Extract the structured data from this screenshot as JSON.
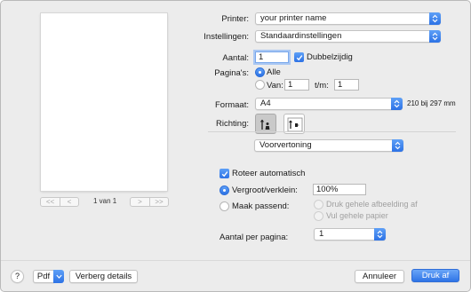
{
  "preview": {
    "page_counter": "1 van 1",
    "nav": {
      "first": "<<",
      "prev": "<",
      "next": ">",
      "last": ">>"
    }
  },
  "printer": {
    "label": "Printer:",
    "value": "your printer name"
  },
  "presets": {
    "label": "Instellingen:",
    "value": "Standaardinstellingen"
  },
  "copies": {
    "label": "Aantal:",
    "value": "1",
    "duplex_label": "Dubbelzijdig",
    "duplex_checked": true
  },
  "pages": {
    "label": "Pagina's:",
    "all_label": "Alle",
    "from_label": "Van:",
    "from_value": "1",
    "to_label": "t/m:",
    "to_value": "1",
    "selected": "all"
  },
  "paper": {
    "label": "Formaat:",
    "value": "A4",
    "dimensions": "210 bij 297 mm"
  },
  "orientation": {
    "label": "Richting:",
    "selected": "portrait"
  },
  "section": {
    "value": "Voorvertoning"
  },
  "preview_options": {
    "auto_rotate_label": "Roteer automatisch",
    "auto_rotate_checked": true,
    "scale_label": "Vergroot/verklein:",
    "scale_value": "100%",
    "fit_label": "Maak passend:",
    "fit_print_label": "Druk gehele afbeelding af",
    "fit_fill_label": "Vul gehele papier",
    "selected": "scale",
    "copies_per_page_label": "Aantal per pagina:",
    "copies_per_page_value": "1"
  },
  "footer": {
    "help_label": "?",
    "pdf_label": "Pdf",
    "hide_details_label": "Verberg details",
    "cancel_label": "Annuleer",
    "print_label": "Druk af"
  },
  "colors": {
    "accent": "#2f74e6",
    "background": "#ececec"
  }
}
